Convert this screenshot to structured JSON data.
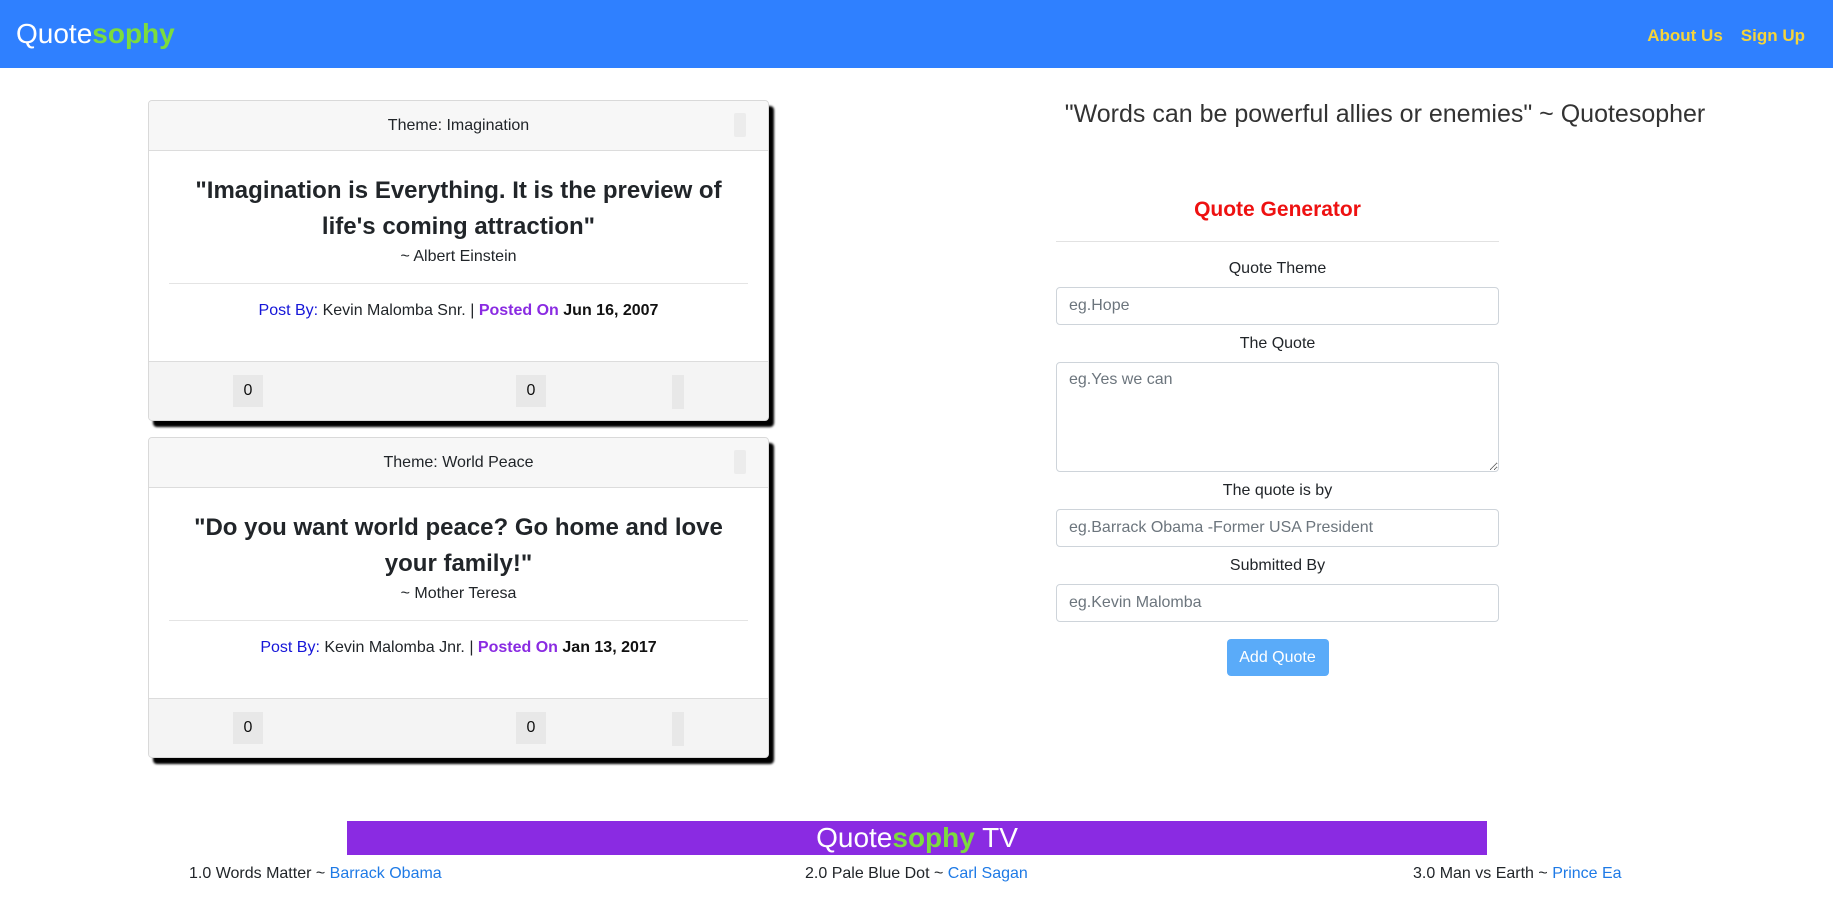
{
  "nav": {
    "brand_prefix": "Quote",
    "brand_accent": "sophy",
    "links": [
      {
        "label": "About Us"
      },
      {
        "label": "Sign Up"
      }
    ]
  },
  "quotes": [
    {
      "theme": "Theme: Imagination",
      "text": "\"Imagination is Everything. It is the preview of life's coming attraction\"",
      "author": "~ Albert Einstein",
      "post_by_label": "Post By:",
      "poster": "Kevin Malomba Snr.",
      "separator": "|",
      "posted_on_label": "Posted On",
      "date": "Jun 16, 2007",
      "upvotes": "0",
      "downvotes": "0"
    },
    {
      "theme": "Theme: World Peace",
      "text": "\"Do you want world peace? Go home and love your family!\"",
      "author": "~ Mother Teresa",
      "post_by_label": "Post By:",
      "poster": "Kevin Malomba Jnr.",
      "separator": "|",
      "posted_on_label": "Posted On",
      "date": "Jan 13, 2017",
      "upvotes": "0",
      "downvotes": "0"
    }
  ],
  "motto": "\"Words can be powerful allies or enemies\" ~ Quotesopher",
  "form": {
    "title": "Quote Generator",
    "theme_label": "Quote Theme",
    "theme_placeholder": "eg.Hope",
    "quote_label": "The Quote",
    "quote_placeholder": "eg.Yes we can",
    "by_label": "The quote is by",
    "by_placeholder": "eg.Barrack Obama -Former USA President",
    "submitted_label": "Submitted By",
    "submitted_placeholder": "eg.Kevin Malomba",
    "submit_label": "Add Quote"
  },
  "tv": {
    "title_prefix": "Quote",
    "title_accent": "sophy",
    "title_suffix": " TV",
    "items": [
      {
        "text": "1.0 Words Matter ~ ",
        "link": "Barrack Obama"
      },
      {
        "text": "2.0 Pale Blue Dot ~ ",
        "link": "Carl Sagan"
      },
      {
        "text": "3.0 Man vs Earth ~ ",
        "link": "Prince Ea"
      }
    ]
  },
  "colors": {
    "navbar": "#2f80ff",
    "brand_accent": "#7cdc3e",
    "nav_link": "#f5d43a",
    "form_title": "#ee1111",
    "post_by": "#1515d8",
    "posted_on": "#8a2be2",
    "tv_banner": "#8a2be2",
    "submit_button": "#5aabf9",
    "link": "#1e7ae6"
  }
}
